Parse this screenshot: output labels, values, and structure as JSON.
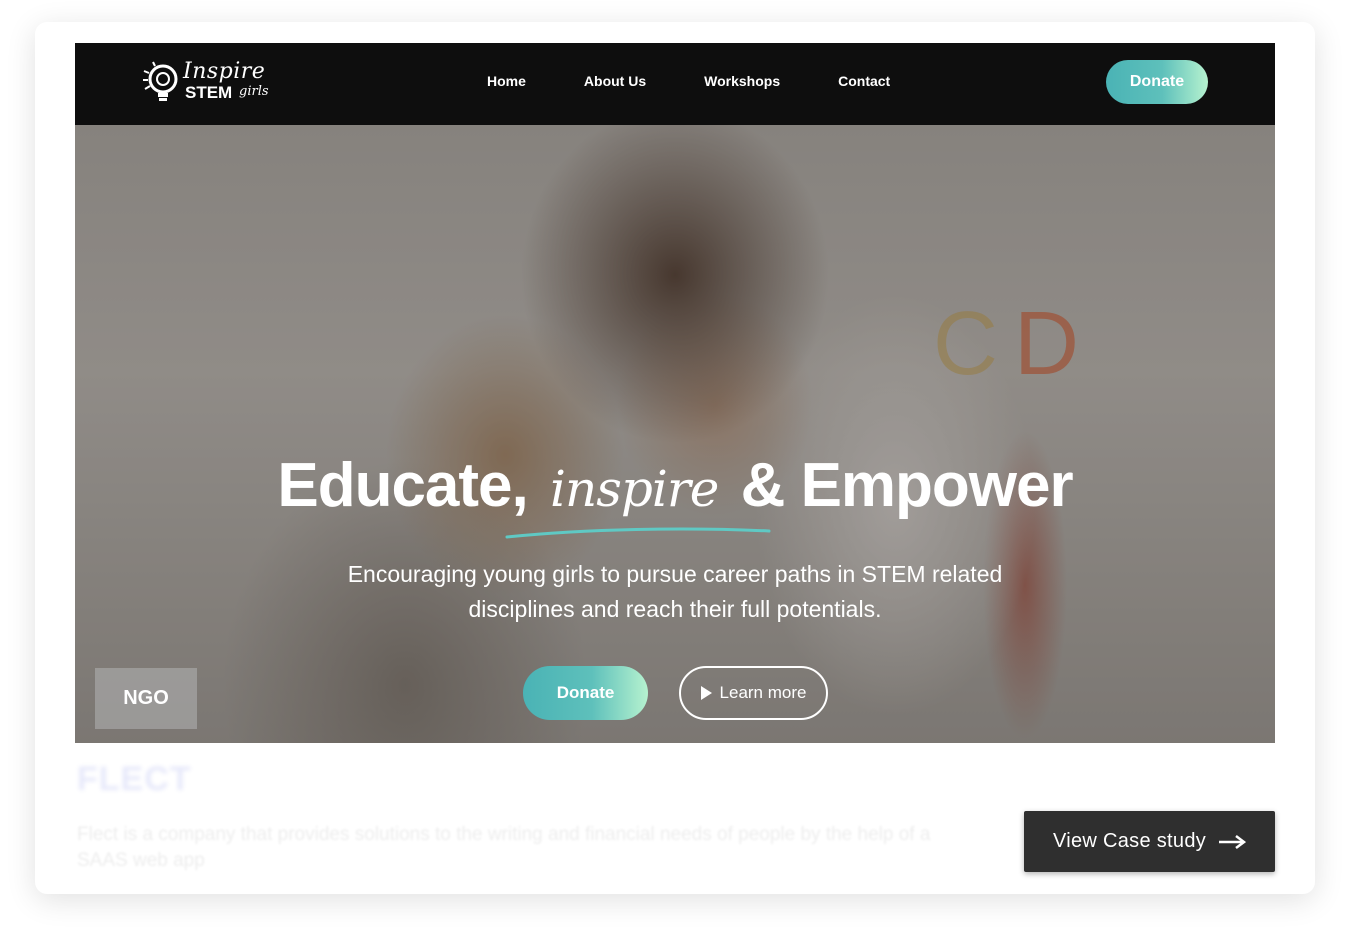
{
  "nav": {
    "logo_word1": "Inspire",
    "logo_word2": "STEM",
    "logo_word3": "girls",
    "links": [
      "Home",
      "About Us",
      "Workshops",
      "Contact"
    ],
    "donate_label": "Donate"
  },
  "hero": {
    "title_part1": "Educate,",
    "title_script": "inspire",
    "title_part2": "& Empower",
    "subtitle": "Encouraging young girls to pursue career paths in STEM related disciplines and reach their full potentials.",
    "donate_label": "Donate",
    "learn_more_label": "Learn more",
    "badge": "NGO",
    "background_letters": [
      "C",
      "D"
    ]
  },
  "case": {
    "brand": "FLECT",
    "description": "Flect is a company that provides solutions to the writing and financial needs of people by the help of a SAAS web app",
    "button_label": "View Case study"
  },
  "colors": {
    "nav_bg": "#0e0e0e",
    "accent_teal": "#4ab3b5",
    "accent_mint": "#b6f2cf",
    "case_button_bg": "#2f2f2f"
  }
}
